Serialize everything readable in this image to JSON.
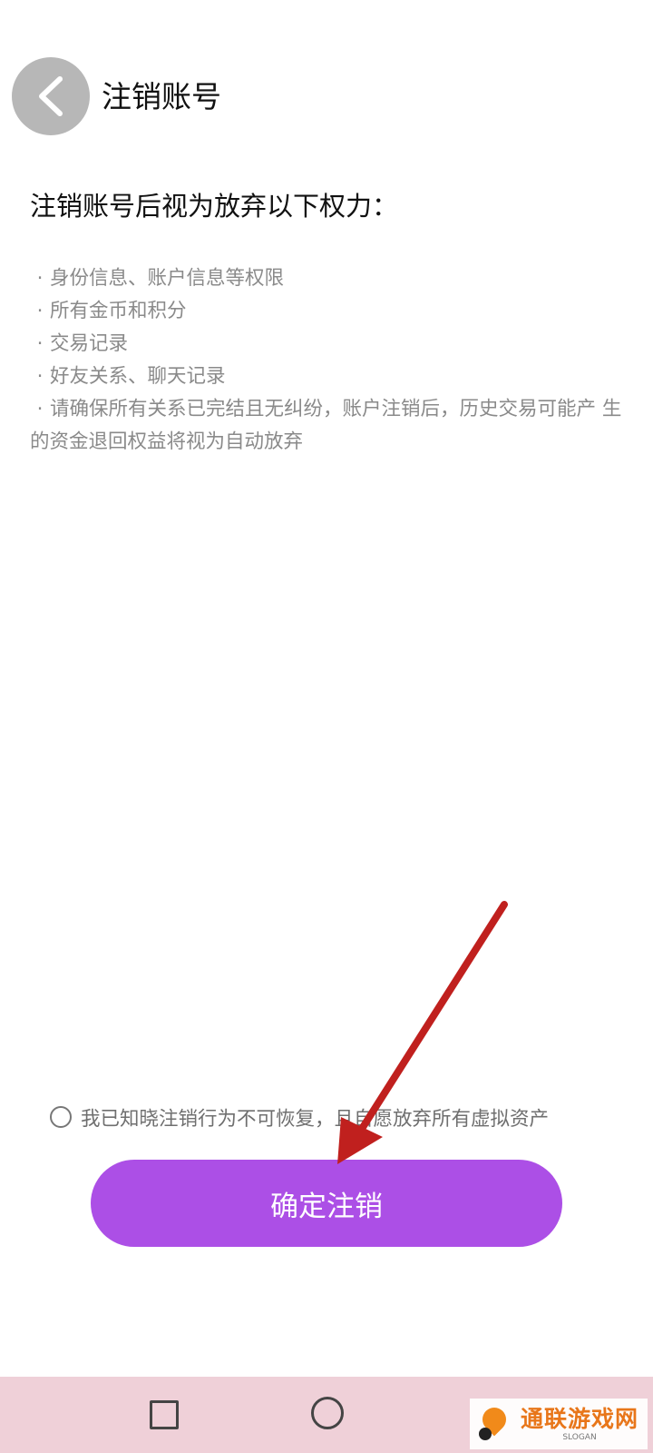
{
  "header": {
    "title": "注销账号",
    "back_icon": "chevron-left-icon"
  },
  "main": {
    "section_title": "注销账号后视为放弃以下权力：",
    "bullet": "·",
    "rights": [
      "身份信息、账户信息等权限",
      "所有金币和积分",
      "交易记录",
      "好友关系、聊天记录",
      "请确保所有关系已完结且无纠纷，账户注销后，历史交易可能产 生的资金退回权益将视为自动放弃"
    ]
  },
  "consent": {
    "label": "我已知晓注销行为不可恢复，且自愿放弃所有虚拟资产",
    "checked": false
  },
  "actions": {
    "confirm_label": "确定注销"
  },
  "nav": {
    "recent_icon": "square-icon",
    "home_icon": "circle-icon"
  },
  "watermark": {
    "brand": "通联游戏网",
    "slogan": "SLOGAN"
  },
  "colors": {
    "accent": "#ac4fe6",
    "back_button_bg": "#b7b7b7",
    "nav_bar_bg": "#efd0d8",
    "annotation_arrow": "#c0201e",
    "watermark_brand": "#e8761a"
  }
}
